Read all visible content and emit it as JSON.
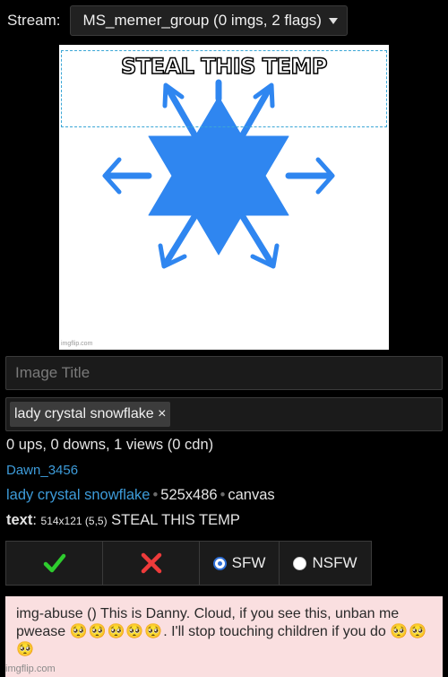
{
  "stream": {
    "label": "Stream:",
    "selected": "MS_memer_group (0 imgs, 2 flags)"
  },
  "meme": {
    "caption": "STEAL THIS TEMP",
    "watermark": "imgflip.com",
    "colors": {
      "snowflake": "#2f86f0",
      "background": "#ffffff"
    }
  },
  "form": {
    "title_placeholder": "Image Title",
    "tags": [
      {
        "text": "lady crystal snowflake",
        "remove": "×"
      }
    ]
  },
  "stats": {
    "line": "0 ups, 0 downs, 1 views (0 cdn)",
    "user": "Dawn_3456",
    "template_link": "lady crystal snowflake",
    "dimensions": "525x486",
    "kind": "canvas"
  },
  "text_info": {
    "label": "text",
    "size": "514x121 (5,5)",
    "value": "STEAL THIS TEMP"
  },
  "actions": {
    "approve_icon": "check-icon",
    "reject_icon": "x-icon",
    "sfw_label": "SFW",
    "nsfw_label": "NSFW",
    "sfw_selected": true
  },
  "flag": {
    "text_before": "img-abuse () This is Danny. Cloud, if you see this, unban me pwease",
    "emojis_1": "🥺🥺🥺🥺🥺",
    "text_after": ". I'll stop touching children if you do",
    "emojis_2": "🥺🥺🥺"
  },
  "footer": {
    "watermark": "imgflip.com"
  }
}
